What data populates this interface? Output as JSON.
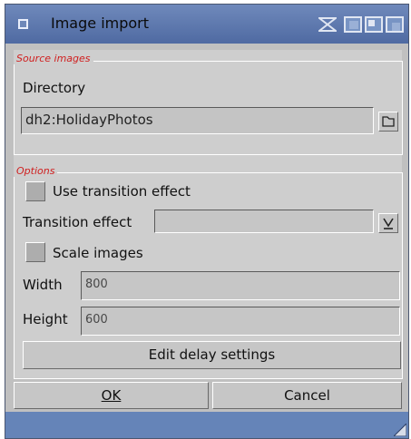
{
  "window": {
    "title": "Image import",
    "titlebar_icons": [
      "depth-icon",
      "iconify-icon",
      "zoom-icon",
      "snapshot-icon"
    ]
  },
  "source_images": {
    "group_label": "Source images",
    "directory_label": "Directory",
    "directory_value": "dh2:HolidayPhotos",
    "browse_icon": "drawer-icon"
  },
  "options": {
    "group_label": "Options",
    "use_transition_label": "Use transition effect",
    "use_transition_checked": false,
    "transition_effect_label": "Transition effect",
    "transition_effect_value": "",
    "transition_dropdown_icon": "chevron-down-icon",
    "scale_images_label": "Scale images",
    "scale_images_checked": false,
    "width_label": "Width",
    "width_value": "800",
    "height_label": "Height",
    "height_value": "600",
    "edit_delay_label": "Edit delay settings"
  },
  "buttons": {
    "ok_label": "OK",
    "cancel_label": "Cancel"
  },
  "colors": {
    "titlebar": "#5c77ad",
    "group_label": "#d02020",
    "background": "#cecece"
  }
}
